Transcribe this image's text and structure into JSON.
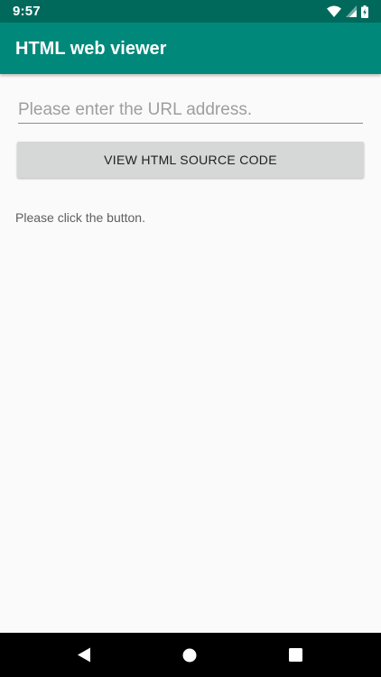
{
  "status_bar": {
    "time": "9:57",
    "icons": [
      "wifi-icon",
      "cellular-signal-icon",
      "battery-charging-icon"
    ]
  },
  "app_bar": {
    "title": "HTML web viewer",
    "color": "#00897b"
  },
  "url_input": {
    "placeholder": "Please enter the URL address.",
    "value": ""
  },
  "view_button": {
    "label": "VIEW HTML SOURCE CODE"
  },
  "result": {
    "text": "Please click the button."
  },
  "nav_bar": {
    "icons": [
      "back-icon",
      "home-icon",
      "recents-icon"
    ]
  },
  "colors": {
    "status_bar": "#00695c",
    "primary": "#00897b",
    "background": "#fafafa",
    "button": "#d6d7d7"
  }
}
